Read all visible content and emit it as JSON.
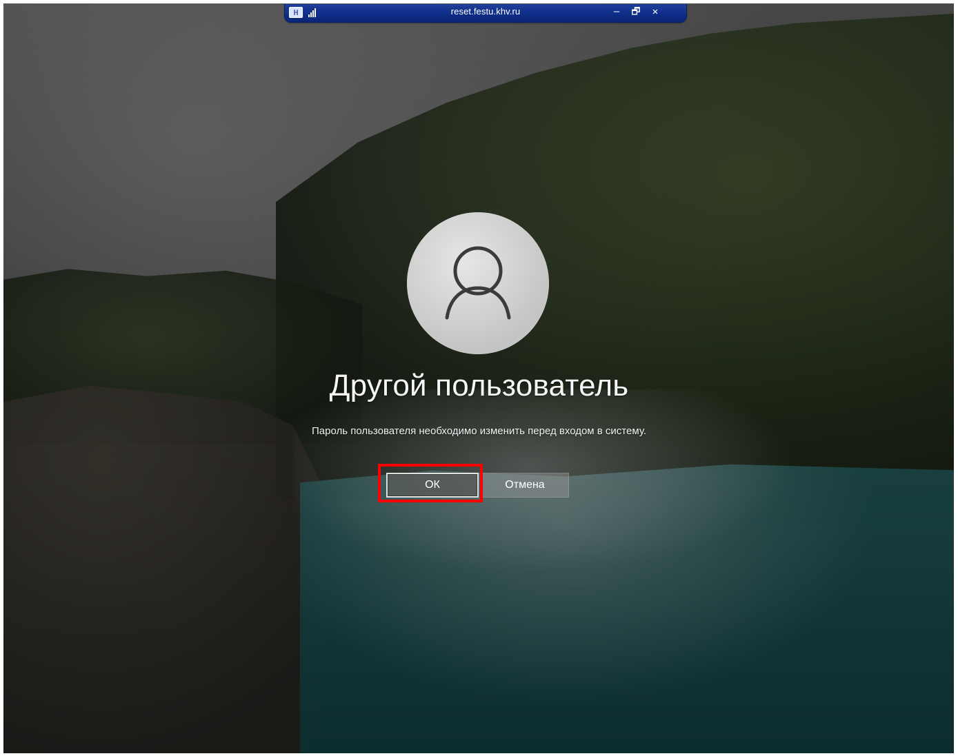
{
  "remote_bar": {
    "title": "reset.festu.khv.ru",
    "pin_label": "H",
    "minimize": "–",
    "restore": "🗗",
    "close": "✕"
  },
  "login": {
    "user_title": "Другой пользователь",
    "message": "Пароль пользователя необходимо изменить перед входом в систему.",
    "ok_label": "ОК",
    "cancel_label": "Отмена"
  },
  "colors": {
    "highlight": "#ff0000",
    "rdp_bar": "#0f2e8a"
  },
  "icons": {
    "user_avatar": "user-avatar-icon",
    "signal": "signal-icon",
    "pin": "pin-icon"
  }
}
